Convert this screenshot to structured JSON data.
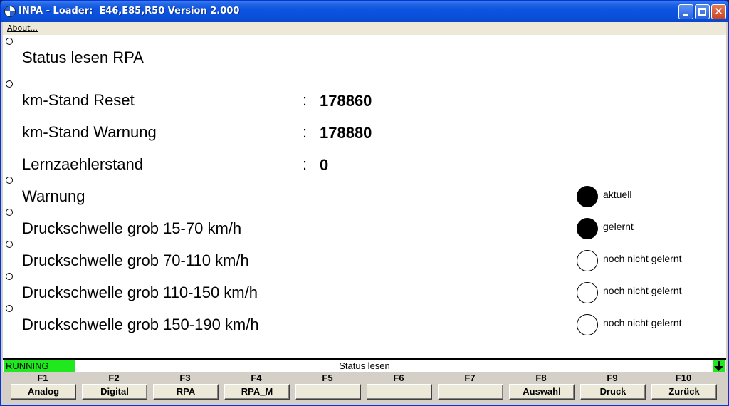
{
  "window": {
    "title": "INPA - Loader:  E46,E85,R50 Version 2.000"
  },
  "menu": {
    "about": "About..."
  },
  "content": {
    "heading": "Status lesen RPA",
    "values": [
      {
        "label": "km-Stand Reset",
        "value": "178860"
      },
      {
        "label": "km-Stand Warnung",
        "value": "178880"
      },
      {
        "label": "Lernzaehlerstand",
        "value": "0"
      }
    ],
    "colon": ":",
    "indicators": [
      {
        "label": "Warnung",
        "state": "on",
        "status": "aktuell"
      },
      {
        "label": "Druckschwelle grob 15-70 km/h",
        "state": "on",
        "status": "gelernt"
      },
      {
        "label": "Druckschwelle grob 70-110 km/h",
        "state": "off",
        "status": "noch nicht gelernt"
      },
      {
        "label": "Druckschwelle grob 110-150 km/h",
        "state": "off",
        "status": "noch nicht gelernt"
      },
      {
        "label": "Druckschwelle grob 150-190 km/h",
        "state": "off",
        "status": "noch nicht gelernt"
      }
    ]
  },
  "status": {
    "running": "RUNNING",
    "center": "Status lesen",
    "running_color": "#1fe81f"
  },
  "fkeys": [
    {
      "key": "F1",
      "label": "Analog"
    },
    {
      "key": "F2",
      "label": "Digital"
    },
    {
      "key": "F3",
      "label": "RPA"
    },
    {
      "key": "F4",
      "label": "RPA_M"
    },
    {
      "key": "F5",
      "label": ""
    },
    {
      "key": "F6",
      "label": ""
    },
    {
      "key": "F7",
      "label": ""
    },
    {
      "key": "F8",
      "label": "Auswahl"
    },
    {
      "key": "F9",
      "label": "Druck"
    },
    {
      "key": "F10",
      "label": "Zurück"
    }
  ]
}
